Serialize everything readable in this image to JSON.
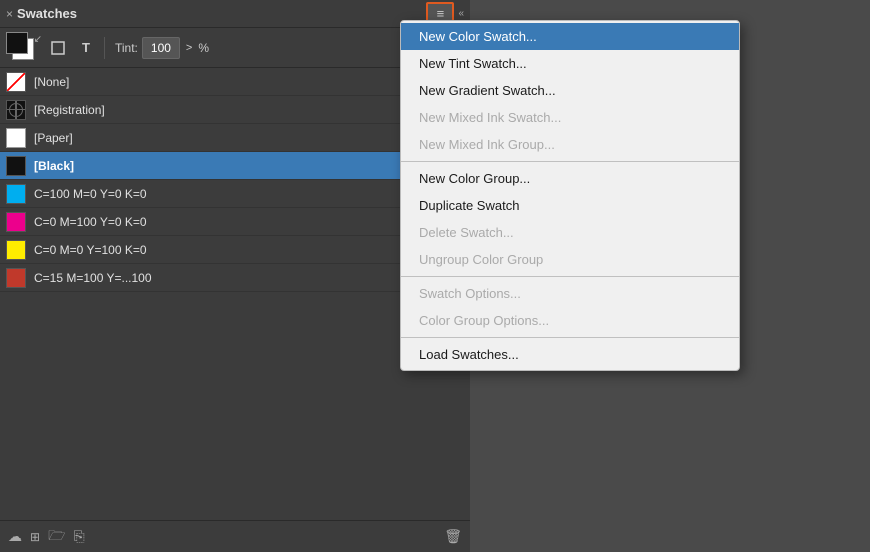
{
  "panel": {
    "title": "Swatches",
    "close_label": "×",
    "collapse_label": "«",
    "menu_icon": "≡",
    "toolbar": {
      "tint_label": "Tint:",
      "tint_value": "100",
      "tint_arrow": ">",
      "tint_percent": "%"
    },
    "swatches": [
      {
        "id": "none",
        "name": "[None]",
        "color": "none",
        "selected": false
      },
      {
        "id": "registration",
        "name": "[Registration]",
        "color": "registration",
        "selected": false
      },
      {
        "id": "paper",
        "name": "[Paper]",
        "color": "white",
        "selected": false
      },
      {
        "id": "black",
        "name": "[Black]",
        "color": "black",
        "selected": true
      },
      {
        "id": "cyan",
        "name": "C=100 M=0 Y=0 K=0",
        "color": "#00aeef",
        "selected": false
      },
      {
        "id": "magenta",
        "name": "C=0 M=100 Y=0 K=0",
        "color": "#ec008c",
        "selected": false
      },
      {
        "id": "yellow",
        "name": "C=0 M=0 Y=100 K=0",
        "color": "#ffed00",
        "selected": false
      },
      {
        "id": "partial",
        "name": "C=15 M=100 Y=...",
        "color": "#c0392b",
        "selected": false
      }
    ],
    "bottom_icons": [
      "cloud-icon",
      "grid-icon",
      "folder-icon",
      "bookmark-icon",
      "trash-icon"
    ]
  },
  "context_menu": {
    "items": [
      {
        "id": "new-color-swatch",
        "label": "New Color Swatch...",
        "state": "highlighted",
        "separator_after": false
      },
      {
        "id": "new-tint-swatch",
        "label": "New Tint Swatch...",
        "state": "normal",
        "separator_after": false
      },
      {
        "id": "new-gradient-swatch",
        "label": "New Gradient Swatch...",
        "state": "normal",
        "separator_after": false
      },
      {
        "id": "new-mixed-ink-swatch",
        "label": "New Mixed Ink Swatch...",
        "state": "disabled",
        "separator_after": false
      },
      {
        "id": "new-mixed-ink-group",
        "label": "New Mixed Ink Group...",
        "state": "disabled",
        "separator_after": true
      },
      {
        "id": "new-color-group",
        "label": "New Color Group...",
        "state": "normal",
        "separator_after": false
      },
      {
        "id": "duplicate-swatch",
        "label": "Duplicate Swatch",
        "state": "normal",
        "separator_after": false
      },
      {
        "id": "delete-swatch",
        "label": "Delete Swatch...",
        "state": "disabled",
        "separator_after": false
      },
      {
        "id": "ungroup-color-group",
        "label": "Ungroup Color Group",
        "state": "disabled",
        "separator_after": true
      },
      {
        "id": "swatch-options",
        "label": "Swatch Options...",
        "state": "disabled",
        "separator_after": false
      },
      {
        "id": "color-group-options",
        "label": "Color Group Options...",
        "state": "disabled",
        "separator_after": true
      },
      {
        "id": "load-swatches",
        "label": "Load Swatches...",
        "state": "normal",
        "separator_after": false
      }
    ]
  }
}
